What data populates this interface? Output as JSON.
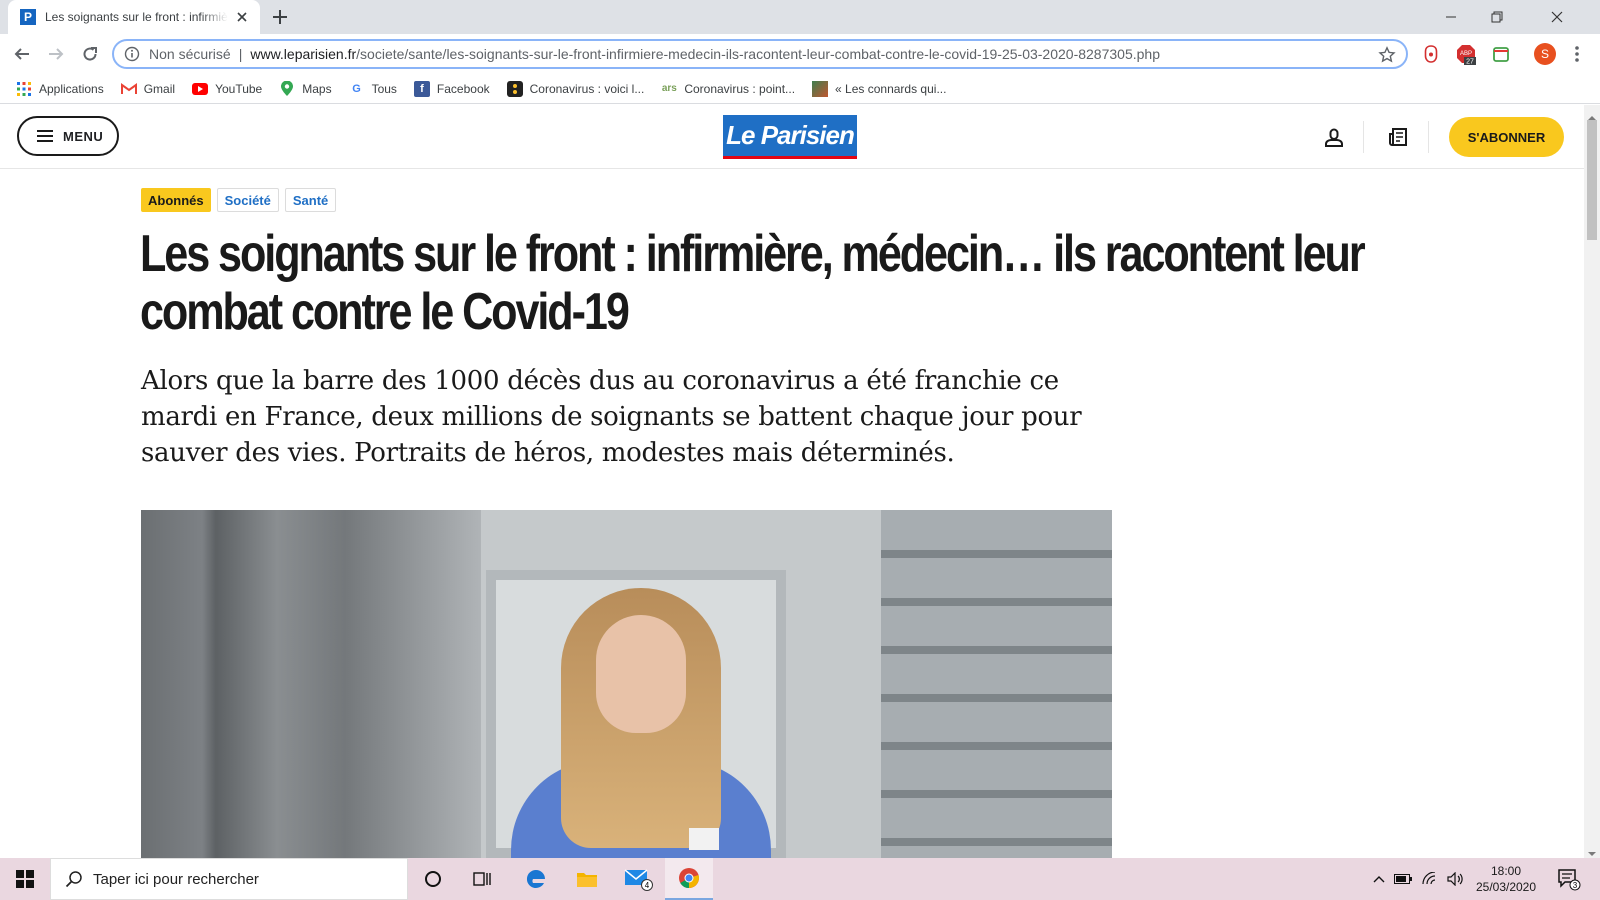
{
  "browser": {
    "tab_title": "Les soignants sur le front : infirmière, médecin",
    "tab_favicon": "P",
    "omnibox": {
      "security": "Non sécurisé",
      "separator": "|",
      "host": "www.leparisien.fr",
      "path": "/societe/sante/les-soignants-sur-le-front-infirmiere-medecin-ils-racontent-leur-combat-contre-le-covid-19-25-03-2020-8287305.php"
    },
    "extension_badge": "27",
    "profile_initial": "S",
    "bookmarks": [
      {
        "label": "Applications",
        "icon": "apps-grid-icon"
      },
      {
        "label": "Gmail",
        "icon": "gmail-icon"
      },
      {
        "label": "YouTube",
        "icon": "youtube-icon"
      },
      {
        "label": "Maps",
        "icon": "maps-icon"
      },
      {
        "label": "Tous",
        "icon": "google-icon"
      },
      {
        "label": "Facebook",
        "icon": "facebook-icon"
      },
      {
        "label": "Coronavirus : voici l...",
        "icon": "site-icon"
      },
      {
        "label": "Coronavirus : point...",
        "icon": "ars-icon"
      },
      {
        "label": "« Les connards qui...",
        "icon": "image-icon"
      }
    ]
  },
  "site": {
    "menu_label": "MENU",
    "logo_text": "Le Parisien",
    "subscribe_label": "S'ABONNER",
    "tags": {
      "subscriber": "Abonnés",
      "cat1": "Société",
      "cat2": "Santé"
    },
    "headline": "Les soignants sur le front : infirmière, médecin… ils racontent leur combat contre le Covid-19",
    "lede": "Alors que la barre des 1000 décès dus au coronavirus a été franchie ce mardi en France, deux millions de soignants se battent chaque jour pour sauver des vies. Portraits de héros, modestes mais déterminés."
  },
  "taskbar": {
    "search_placeholder": "Taper ici pour rechercher",
    "mail_badge": "4",
    "time": "18:00",
    "date": "25/03/2020",
    "notifications": "3"
  },
  "colors": {
    "brand_blue": "#1f6fc5",
    "accent_yellow": "#f9c81e",
    "taskbar": "#ead7e0"
  }
}
